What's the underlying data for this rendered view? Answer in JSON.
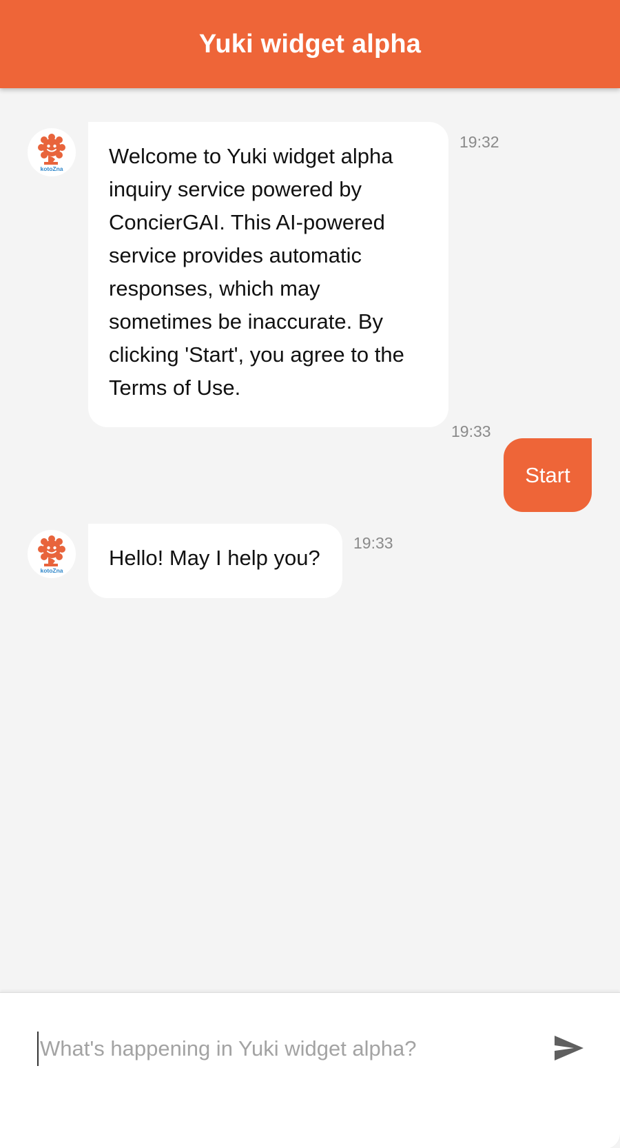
{
  "header": {
    "title": "Yuki widget alpha",
    "color": "#ee6538"
  },
  "messages": [
    {
      "sender": "bot",
      "avatar_icon": "kotozna-mascot-icon",
      "avatar_caption": "kotoZna",
      "text": "Welcome to Yuki widget alpha inquiry service powered by ConcierGAI. This AI-powered service provides automatic responses, which may sometimes be inaccurate. By clicking 'Start', you agree to the Terms of Use.",
      "time": "19:32"
    },
    {
      "sender": "user",
      "text": "Start",
      "time": "19:33"
    },
    {
      "sender": "bot",
      "avatar_icon": "kotozna-mascot-icon",
      "avatar_caption": "kotoZna",
      "text": "Hello! May I help you?",
      "time": "19:33"
    }
  ],
  "composer": {
    "placeholder": "What's happening in Yuki widget alpha?",
    "value": "",
    "send_icon": "send-icon"
  }
}
